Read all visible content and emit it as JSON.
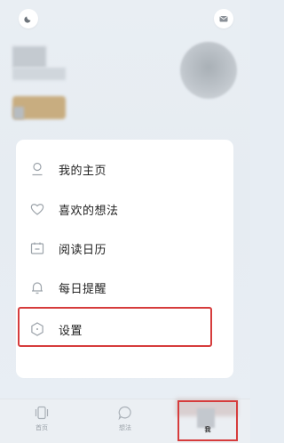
{
  "topbar": {
    "left_icon": "moon-icon",
    "right_icon": "mail-icon"
  },
  "menu": {
    "items": [
      {
        "label": "我的主页",
        "icon": "person-icon"
      },
      {
        "label": "喜欢的想法",
        "icon": "heart-icon"
      },
      {
        "label": "阅读日历",
        "icon": "calendar-icon"
      },
      {
        "label": "每日提醒",
        "icon": "bell-icon"
      },
      {
        "label": "设置",
        "icon": "settings-hexagon-icon"
      }
    ]
  },
  "tabbar": {
    "tabs": [
      {
        "label": "首页",
        "icon": "home-phone-icon"
      },
      {
        "label": "想法",
        "icon": "chat-bubble-icon"
      },
      {
        "label": "我",
        "icon": "profile-icon"
      }
    ],
    "active_color": "#333333",
    "inactive_color": "#9aa1a8"
  },
  "highlight_color": "#d63c3c"
}
